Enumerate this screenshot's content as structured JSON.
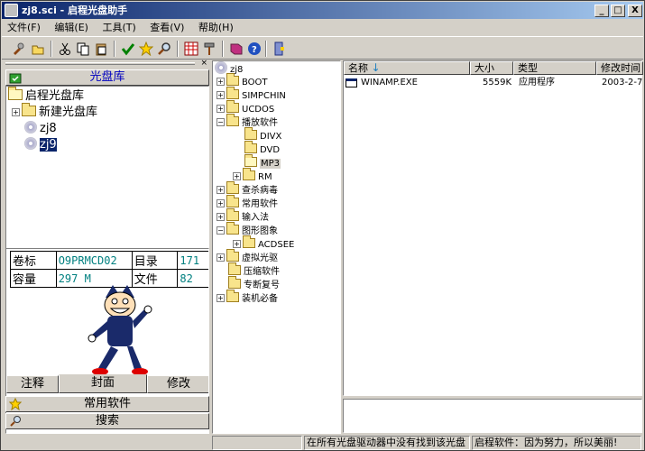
{
  "window": {
    "title": "zj8.sci - 启程光盘助手",
    "min_label": "_",
    "max_label": "□",
    "close_label": "X"
  },
  "menu": [
    {
      "label": "文件(F)"
    },
    {
      "label": "编辑(E)"
    },
    {
      "label": "工具(T)"
    },
    {
      "label": "查看(V)"
    },
    {
      "label": "帮助(H)"
    }
  ],
  "toolbar": {
    "icons": [
      "tools-icon",
      "open-icon",
      "cut-icon",
      "copy-icon",
      "paste-icon",
      "check-icon",
      "star-icon",
      "search-icon",
      "grid-icon",
      "hammer-icon",
      "book-icon",
      "help-icon",
      "exit-icon"
    ]
  },
  "left": {
    "grip_close": "×",
    "library_header": "光盘库",
    "library_tree": [
      {
        "label": "启程光盘库",
        "type": "folder-open",
        "level": 0
      },
      {
        "label": "新建光盘库",
        "type": "folder",
        "level": 1,
        "expander": "+"
      },
      {
        "label": "zj8",
        "type": "cd",
        "level": 1
      },
      {
        "label": "zj9",
        "type": "cd",
        "level": 1,
        "selected": true
      }
    ],
    "info": {
      "label_name": "卷标",
      "value_name": "O9PRMCD02",
      "label_dir": "目录",
      "value_dir": "171",
      "label_size": "容量",
      "value_size": "297 M",
      "label_files": "文件",
      "value_files": "82"
    },
    "tabs": [
      {
        "label": "注释"
      },
      {
        "label": "封面",
        "active": true
      },
      {
        "label": "修改"
      }
    ],
    "common_software": "常用软件",
    "search": "搜索"
  },
  "tree": {
    "root": "zj8",
    "items": [
      {
        "label": "BOOT",
        "level": 1,
        "expander": "+"
      },
      {
        "label": "SIMPCHIN",
        "level": 1,
        "expander": "+"
      },
      {
        "label": "UCDOS",
        "level": 1,
        "expander": "+"
      },
      {
        "label": "播放软件",
        "level": 1,
        "expander": "−"
      },
      {
        "label": "DIVX",
        "level": 2
      },
      {
        "label": "DVD",
        "level": 2
      },
      {
        "label": "MP3",
        "level": 2,
        "selected": true,
        "open": true
      },
      {
        "label": "RM",
        "level": 2,
        "expander": "+"
      },
      {
        "label": "查杀病毒",
        "level": 1,
        "expander": "+"
      },
      {
        "label": "常用软件",
        "level": 1,
        "expander": "+"
      },
      {
        "label": "输入法",
        "level": 1,
        "expander": "+"
      },
      {
        "label": "图形图象",
        "level": 1,
        "expander": "−"
      },
      {
        "label": "ACDSEE",
        "level": 2,
        "expander": "+"
      },
      {
        "label": "虚拟光驱",
        "level": 1,
        "expander": "+"
      },
      {
        "label": "压缩软件",
        "level": 1
      },
      {
        "label": "专断复号",
        "level": 1
      },
      {
        "label": "装机必备",
        "level": 1,
        "expander": "+"
      }
    ]
  },
  "list": {
    "columns": [
      "名称",
      "大小",
      "类型",
      "修改时间"
    ],
    "rows": [
      {
        "name": "WINAMP.EXE",
        "size": "5559K",
        "type": "应用程序",
        "modified": "2003-2-7"
      }
    ]
  },
  "status": {
    "message": "在所有光盘驱动器中没有找到该光盘",
    "slogan": "启程软件：因为努力，所以美丽!"
  }
}
